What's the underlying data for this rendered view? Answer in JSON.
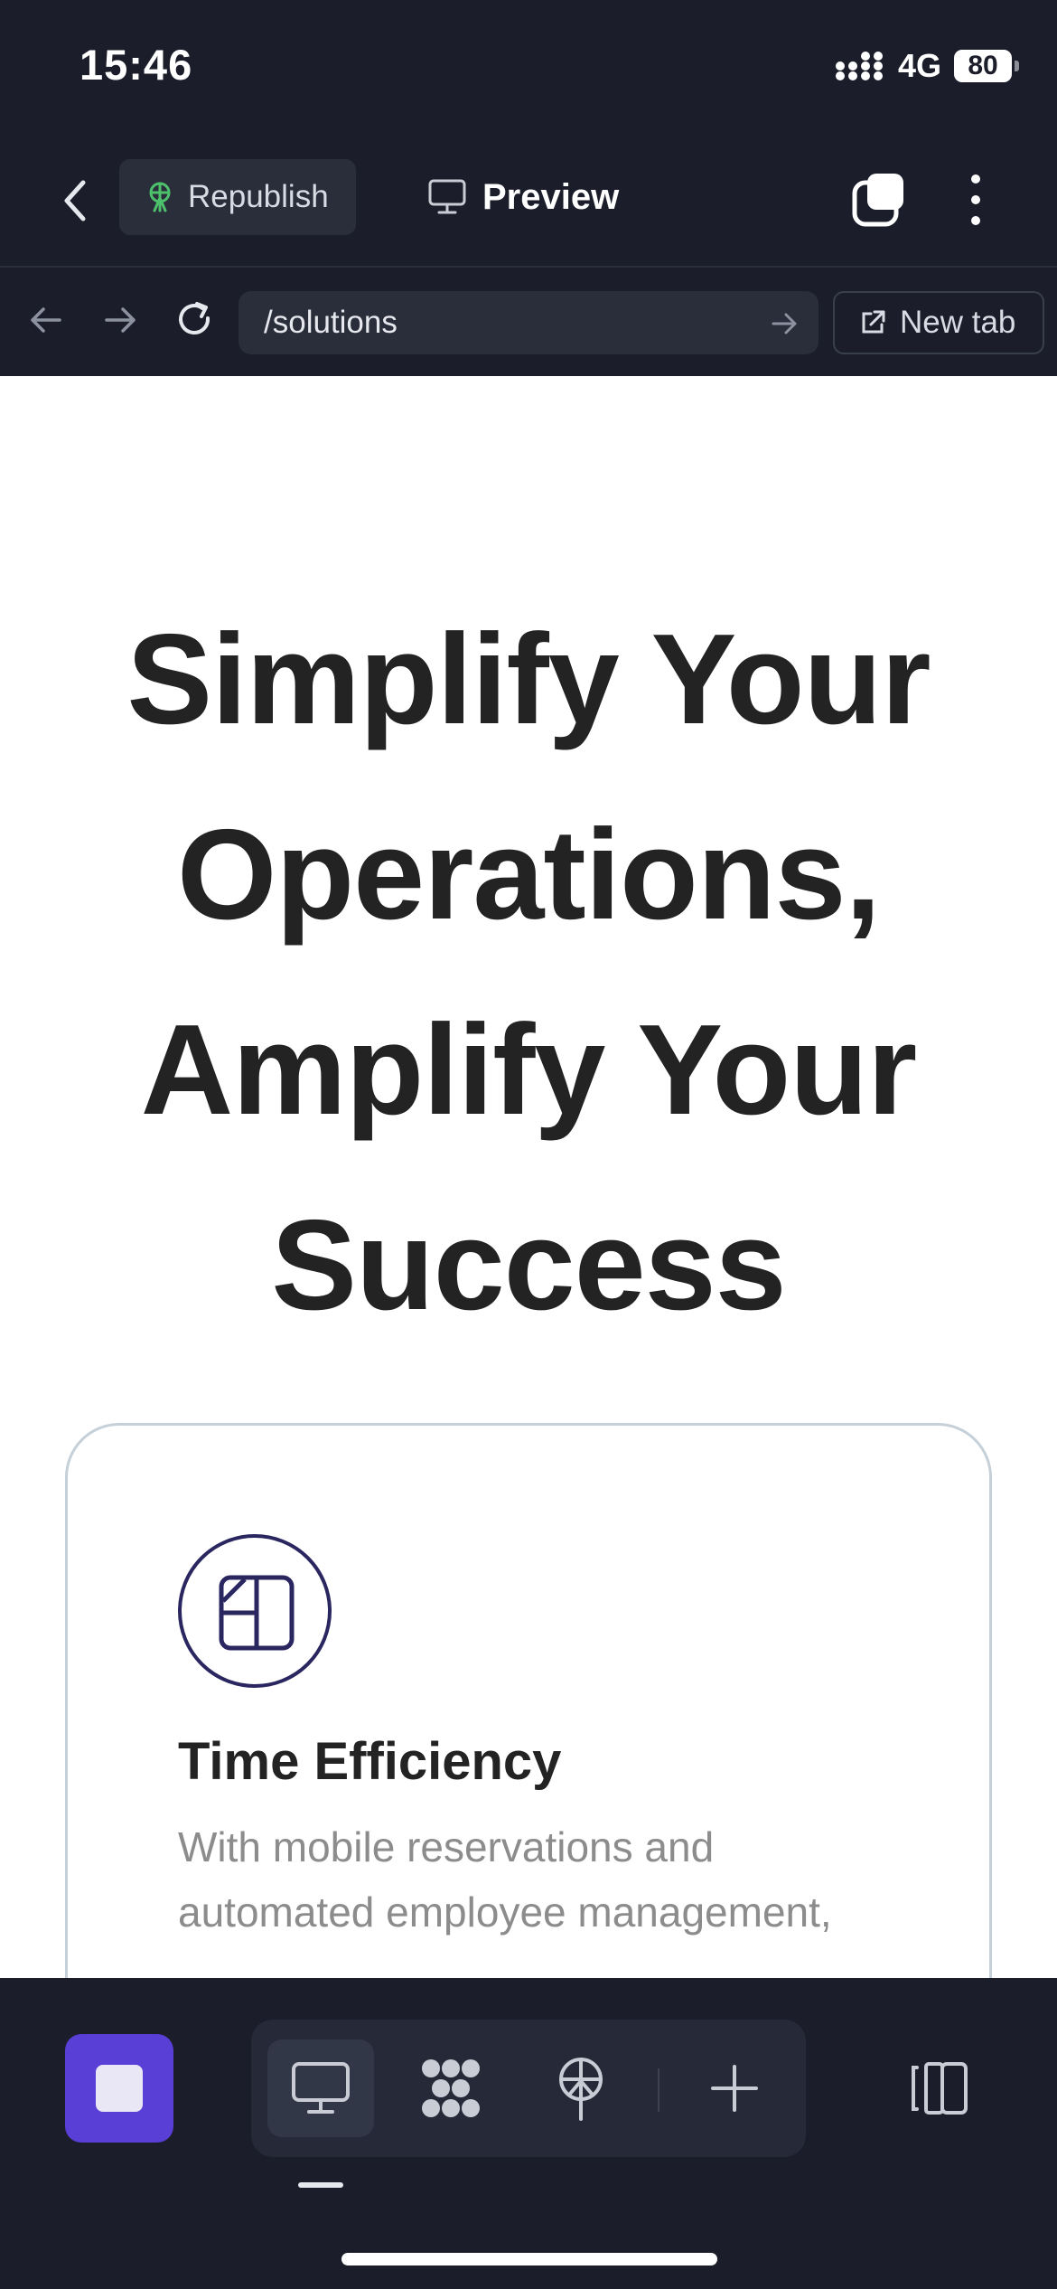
{
  "status_bar": {
    "time": "15:46",
    "network": "4G",
    "battery": "80"
  },
  "toolbar": {
    "republish_label": "Republish",
    "preview_label": "Preview"
  },
  "url_bar": {
    "path": "/solutions",
    "new_tab_label": "New tab"
  },
  "page": {
    "hero_lines": [
      "Simplify Your",
      "Operations,",
      "Amplify Your",
      "Success"
    ],
    "feature_title": "Time Efficiency",
    "feature_desc": "With mobile reservations and automated employee management,"
  },
  "bottom_bar": {
    "active_mode": "desktop",
    "modes": [
      "desktop-icon",
      "components-icon",
      "publish-icon",
      "add-icon"
    ]
  },
  "colors": {
    "chrome_bg": "#1b1e2a",
    "accent": "#5a3fd6",
    "republish_icon": "#4cc06b",
    "feature_icon": "#2a2660"
  }
}
